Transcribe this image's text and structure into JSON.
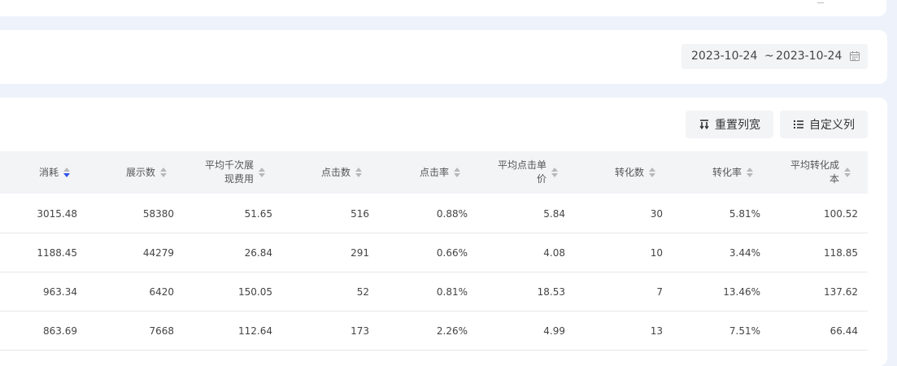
{
  "date_range": {
    "start": "2023-10-24",
    "separator": "~",
    "end": "2023-10-24"
  },
  "toolbar": {
    "reset_label": "重置列宽",
    "custom_label": "自定义列"
  },
  "table": {
    "columns": [
      {
        "label": "消耗",
        "sorted": "desc"
      },
      {
        "label": "展示数",
        "sorted": "none"
      },
      {
        "label_lines": [
          "平均千次展",
          "现费用"
        ],
        "sorted": "none"
      },
      {
        "label": "点击数",
        "sorted": "none"
      },
      {
        "label": "点击率",
        "sorted": "none"
      },
      {
        "label_lines": [
          "平均点击单",
          "价"
        ],
        "sorted": "none"
      },
      {
        "label": "转化数",
        "sorted": "none"
      },
      {
        "label": "转化率",
        "sorted": "none"
      },
      {
        "label_lines": [
          "平均转化成",
          "本"
        ],
        "sorted": "none"
      }
    ],
    "rows": [
      [
        "3015.48",
        "58380",
        "51.65",
        "516",
        "0.88%",
        "5.84",
        "30",
        "5.81%",
        "100.52"
      ],
      [
        "1188.45",
        "44279",
        "26.84",
        "291",
        "0.66%",
        "4.08",
        "10",
        "3.44%",
        "118.85"
      ],
      [
        "963.34",
        "6420",
        "150.05",
        "52",
        "0.81%",
        "18.53",
        "7",
        "13.46%",
        "137.62"
      ],
      [
        "863.69",
        "7668",
        "112.64",
        "173",
        "2.26%",
        "4.99",
        "13",
        "7.51%",
        "66.44"
      ]
    ]
  },
  "colors": {
    "accent": "#2f54eb",
    "header_bg": "#f3f4f6",
    "page_bg": "#eef3fb"
  },
  "icons": {
    "reset": "column-width-icon",
    "custom": "list-icon",
    "date": "calendar-icon"
  }
}
